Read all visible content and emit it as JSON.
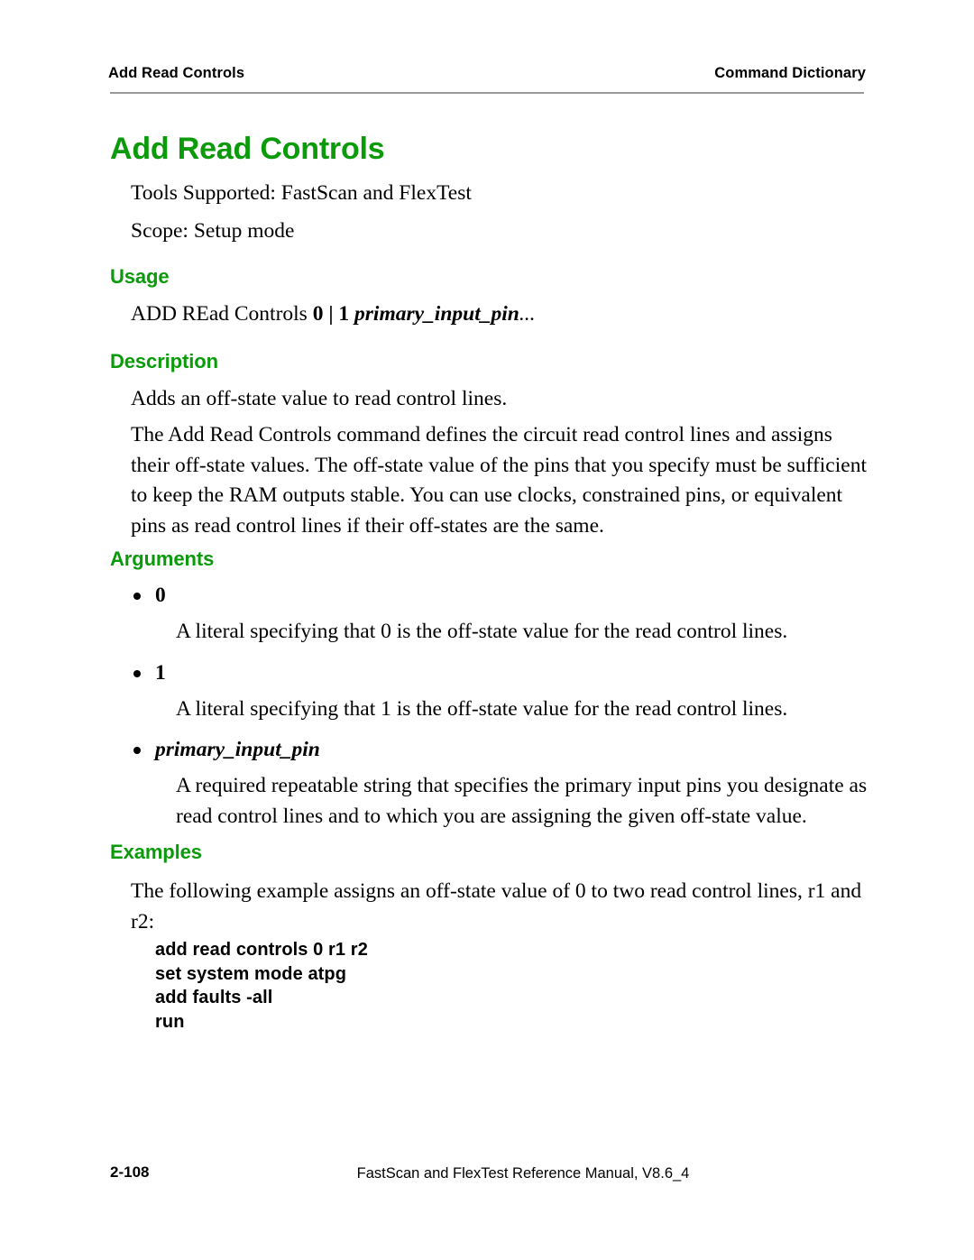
{
  "header": {
    "left": "Add Read Controls",
    "right": "Command Dictionary"
  },
  "title": "Add Read Controls",
  "intro": {
    "tools_supported": "Tools Supported: FastScan and FlexTest",
    "scope": "Scope: Setup mode"
  },
  "sections": {
    "usage": {
      "heading": "Usage",
      "syntax_prefix": "ADD REad Controls ",
      "syntax_zero": "0",
      "syntax_pipe": " | ",
      "syntax_one": "1",
      "syntax_param": " primary_input_pin",
      "syntax_ellipsis": "..."
    },
    "description": {
      "heading": "Description",
      "summary": "Adds an off-state value to read control lines.",
      "detail": "The Add Read Controls command defines the circuit read control lines and assigns their off-state values. The off-state value of the pins that you specify must be sufficient to keep the RAM outputs stable. You can use clocks, constrained pins, or equivalent pins as read control lines if their off-states are the same."
    },
    "arguments": {
      "heading": "Arguments",
      "items": [
        {
          "label": "0",
          "label_style": "bold",
          "text": "A literal specifying that 0 is the off-state value for the read control lines."
        },
        {
          "label": "1",
          "label_style": "bold",
          "text": "A literal specifying that 1 is the off-state value for the read control lines."
        },
        {
          "label": "primary_input_pin",
          "label_style": "bold-italic",
          "text": "A required repeatable string that specifies the primary input pins you designate as read control lines and to which you are assigning the given off-state value."
        }
      ]
    },
    "examples": {
      "heading": "Examples",
      "intro": "The following example assigns an off-state value of 0 to two read control lines, r1 and r2:",
      "code_lines": [
        "add read controls 0 r1 r2",
        "set system mode atpg",
        "add faults -all",
        "run"
      ]
    }
  },
  "footer": {
    "page_number": "2-108",
    "manual": "FastScan and FlexTest Reference Manual, V8.6_4"
  },
  "colors": {
    "heading_green": "#0a9a0a",
    "rule_gray": "#9a9a9a",
    "text_black": "#000000"
  }
}
